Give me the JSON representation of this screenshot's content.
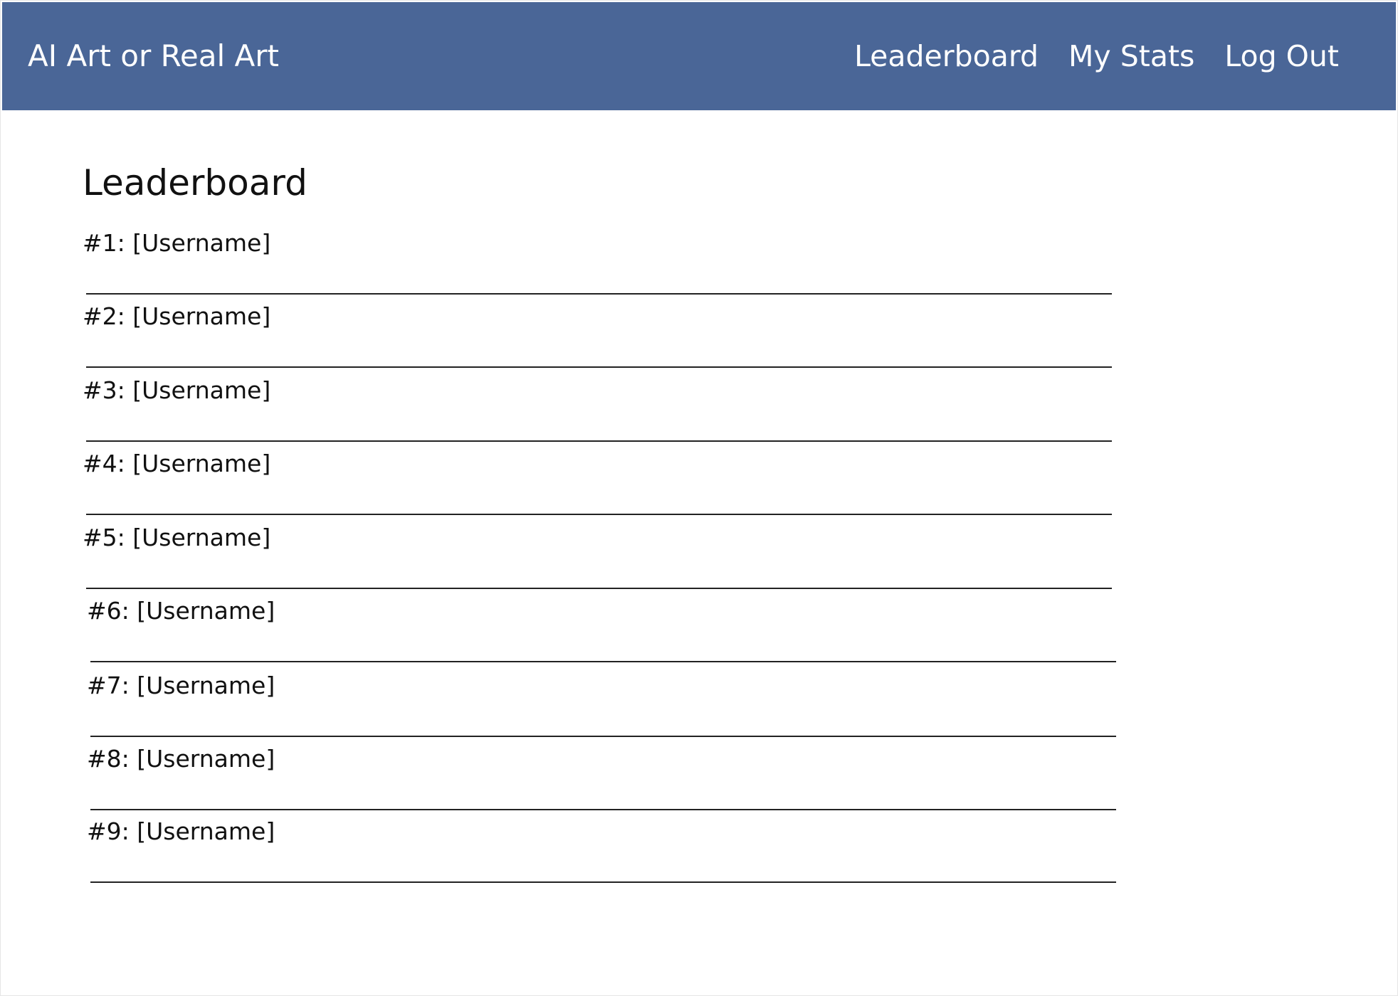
{
  "app": {
    "brand": "AI Art or Real Art"
  },
  "nav": {
    "items": [
      {
        "label": "Leaderboard"
      },
      {
        "label": "My Stats"
      },
      {
        "label": "Log Out"
      }
    ]
  },
  "page": {
    "title": "Leaderboard"
  },
  "leaderboard": {
    "entries": [
      {
        "text": "#1: [Username]"
      },
      {
        "text": "#2: [Username]"
      },
      {
        "text": "#3: [Username]"
      },
      {
        "text": "#4: [Username]"
      },
      {
        "text": "#5: [Username]"
      },
      {
        "text": "#6: [Username]"
      },
      {
        "text": "#7: [Username]"
      },
      {
        "text": "#8: [Username]"
      },
      {
        "text": "#9: [Username]"
      }
    ]
  },
  "colors": {
    "navbar_background": "#4a6697",
    "navbar_text": "#ffffff",
    "page_background": "#ffffff",
    "divider": "#222222"
  }
}
